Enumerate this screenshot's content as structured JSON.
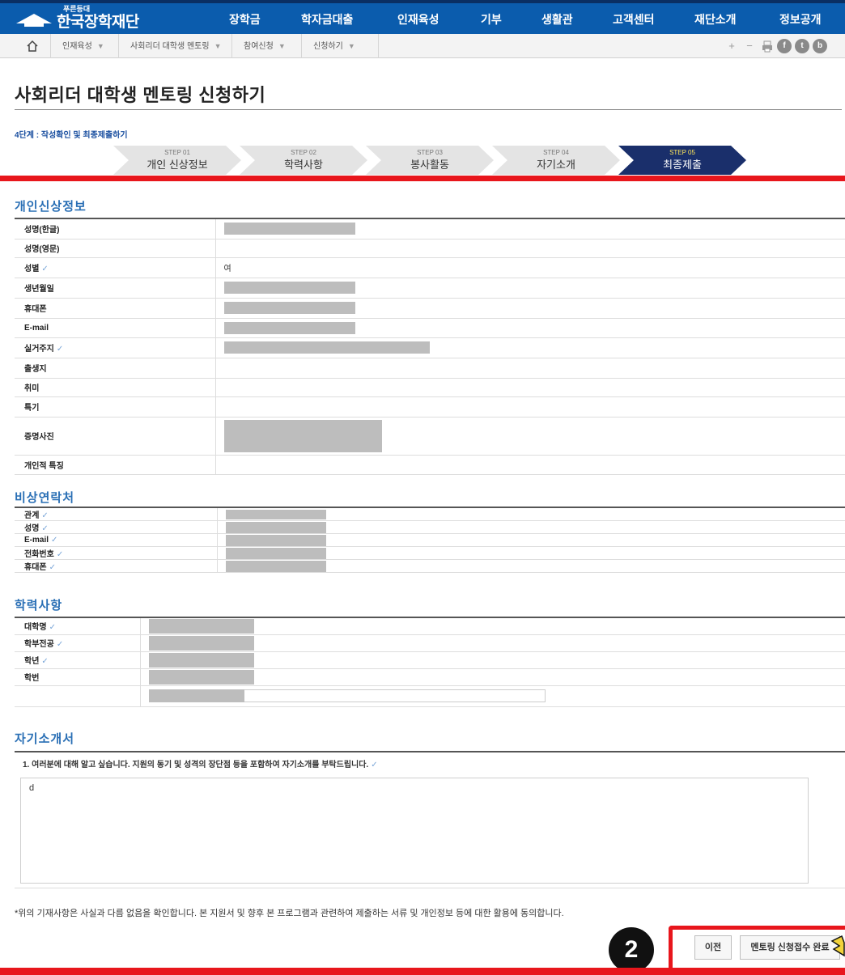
{
  "header": {
    "logo_sub": "푸른등대",
    "logo_name": "한국장학재단",
    "menu": [
      "장학금",
      "학자금대출",
      "인재육성",
      "기부",
      "생활관",
      "고객센터",
      "재단소개",
      "정보공개"
    ]
  },
  "breadcrumb": {
    "items": [
      "인재육성",
      "사회리더 대학생 멘토링",
      "참여신청",
      "신청하기"
    ],
    "tools": [
      "+",
      "−",
      "print-icon",
      "facebook-icon",
      "twitter-icon",
      "blog-icon"
    ]
  },
  "page": {
    "title": "사회리더 대학생 멘토링 신청하기",
    "step_caption": "4단계 : 작성확인 및 최종제출하기"
  },
  "steps": [
    {
      "num": "STEP 01",
      "label": "개인 신상정보"
    },
    {
      "num": "STEP 02",
      "label": "학력사항"
    },
    {
      "num": "STEP 03",
      "label": "봉사활동"
    },
    {
      "num": "STEP 04",
      "label": "자기소개"
    },
    {
      "num": "STEP 05",
      "label": "최종제출"
    }
  ],
  "active_step": 5,
  "personal": {
    "title": "개인신상정보",
    "rows": [
      {
        "label": "성명(한글)",
        "value": "",
        "check": false
      },
      {
        "label": "성명(영문)",
        "value": "",
        "check": false
      },
      {
        "label": "성별",
        "value": "여",
        "check": true
      },
      {
        "label": "생년월일",
        "value": "",
        "check": false
      },
      {
        "label": "휴대폰",
        "value": "",
        "check": false
      },
      {
        "label": "E-mail",
        "value": "",
        "check": false
      },
      {
        "label": "실거주지",
        "value": "",
        "check": true
      },
      {
        "label": "출생지",
        "value": "",
        "check": false
      },
      {
        "label": "취미",
        "value": "",
        "check": false
      },
      {
        "label": "특기",
        "value": "",
        "check": false
      },
      {
        "label": "증명사진",
        "value": "",
        "check": false
      },
      {
        "label": "개인적 특징",
        "value": "",
        "check": false
      }
    ]
  },
  "emergency": {
    "title": "비상연락처",
    "rows": [
      {
        "label": "관계",
        "check": true
      },
      {
        "label": "성명",
        "check": true
      },
      {
        "label": "E-mail",
        "check": true
      },
      {
        "label": "전화번호",
        "check": true
      },
      {
        "label": "휴대폰",
        "check": true
      }
    ]
  },
  "education": {
    "title": "학력사항",
    "rows": [
      {
        "label": "대학명",
        "check": true
      },
      {
        "label": "학부전공",
        "check": true
      },
      {
        "label": "학년",
        "check": true
      },
      {
        "label": "학번",
        "check": false
      },
      {
        "label": "",
        "check": false
      }
    ]
  },
  "essay": {
    "title": "자기소개서",
    "question": "1. 여러분에 대해 알고 싶습니다. 지원의 동기 및 성격의 장단점 등을 포함하여 자기소개를 부탁드립니다.",
    "answer": "d"
  },
  "agreement": "*위의 기재사항은 사실과 다름 없음을 확인합니다. 본 지원서 및 향후 본 프로그램과 관련하여 제출하는 서류 및 개인정보 등에 대한 활용에 동의합니다.",
  "annotation_badge": "2",
  "buttons": {
    "prev": "이전",
    "submit": "멘토링 신청접수 완료"
  },
  "colors": {
    "nav": "#0b5cad",
    "active_step": "#1a2f6b",
    "highlight": "#e8161c",
    "section_title": "#2a6fb5"
  }
}
